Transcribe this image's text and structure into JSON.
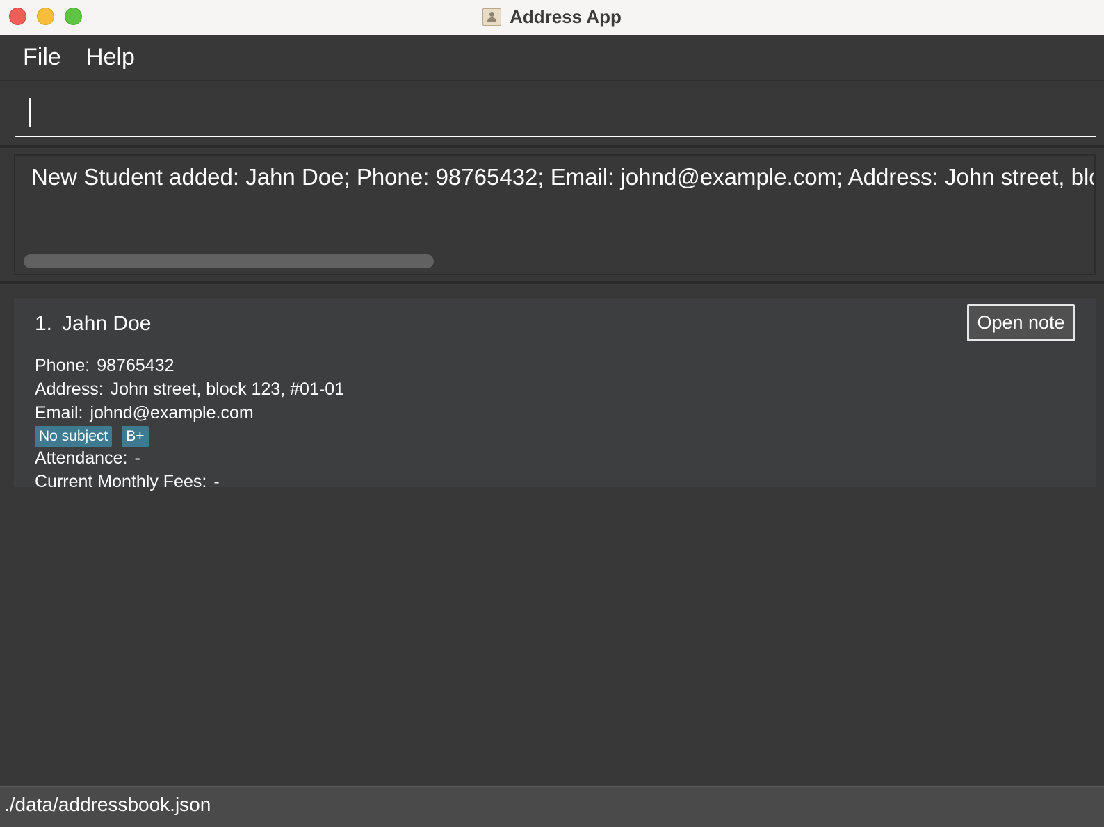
{
  "window": {
    "title": "Address App",
    "icon": "address-book-icon"
  },
  "menu": {
    "file_label": "File",
    "help_label": "Help"
  },
  "command": {
    "value": "",
    "placeholder": ""
  },
  "result": {
    "text": "New Student added: Jahn Doe; Phone: 98765432; Email: johnd@example.com; Address: John street, bloc"
  },
  "students": [
    {
      "index": "1.",
      "name": "Jahn Doe",
      "phone_label": "Phone:",
      "phone": "98765432",
      "address_label": "Address:",
      "address": "John street, block 123, #01-01",
      "email_label": "Email:",
      "email": "johnd@example.com",
      "tags": [
        "No subject",
        "B+"
      ],
      "attendance_label": "Attendance:",
      "attendance": "-",
      "fees_label": "Current Monthly Fees:",
      "fees": "-",
      "open_note_label": "Open note"
    }
  ],
  "status": {
    "path": "./data/addressbook.json"
  },
  "colors": {
    "background": "#383838",
    "card": "#3c3e3f",
    "tag": "#3e7b91",
    "statusbar": "#4a4a4a"
  }
}
